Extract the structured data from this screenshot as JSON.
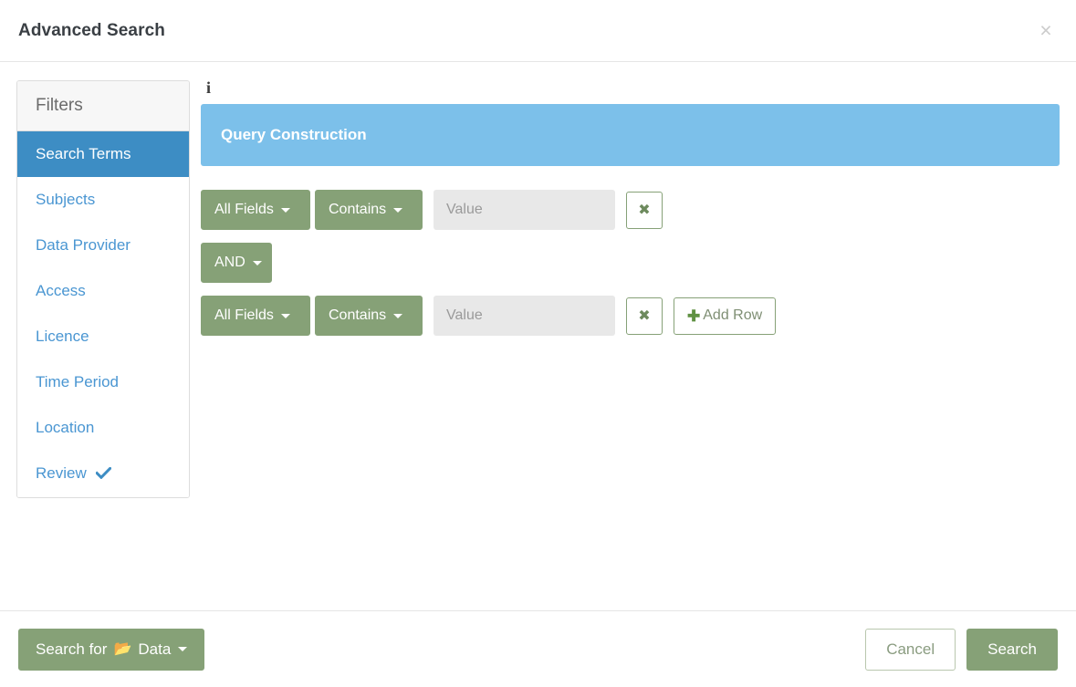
{
  "header": {
    "title": "Advanced Search",
    "close_icon": "close-icon",
    "close_glyph": "×"
  },
  "sidebar": {
    "heading": "Filters",
    "items": [
      {
        "label": "Search Terms",
        "active": true,
        "icon": ""
      },
      {
        "label": "Subjects",
        "active": false,
        "icon": ""
      },
      {
        "label": "Data Provider",
        "active": false,
        "icon": ""
      },
      {
        "label": "Access",
        "active": false,
        "icon": ""
      },
      {
        "label": "Licence",
        "active": false,
        "icon": ""
      },
      {
        "label": "Time Period",
        "active": false,
        "icon": ""
      },
      {
        "label": "Location",
        "active": false,
        "icon": ""
      },
      {
        "label": "Review",
        "active": false,
        "icon": "check-icon"
      }
    ]
  },
  "main": {
    "info_icon_glyph": "i",
    "banner_title": "Query Construction",
    "rows": [
      {
        "field_label": "All Fields",
        "operator_label": "Contains",
        "value": "",
        "value_placeholder": "Value",
        "remove_glyph": "✖"
      },
      {
        "field_label": "All Fields",
        "operator_label": "Contains",
        "value": "",
        "value_placeholder": "Value",
        "remove_glyph": "✖"
      }
    ],
    "boolean_operator": "AND",
    "add_row_label": "Add Row",
    "add_row_glyph": "✚"
  },
  "footer": {
    "search_for_prefix": "Search for",
    "search_for_target": "Data",
    "folder_glyph": "📂",
    "cancel_label": "Cancel",
    "search_label": "Search"
  },
  "colors": {
    "accent_green": "#86a177",
    "banner_blue": "#7cc0ea",
    "active_blue": "#3d8dc4",
    "link_blue": "#4a96d2",
    "input_gray": "#e8e8e8"
  }
}
